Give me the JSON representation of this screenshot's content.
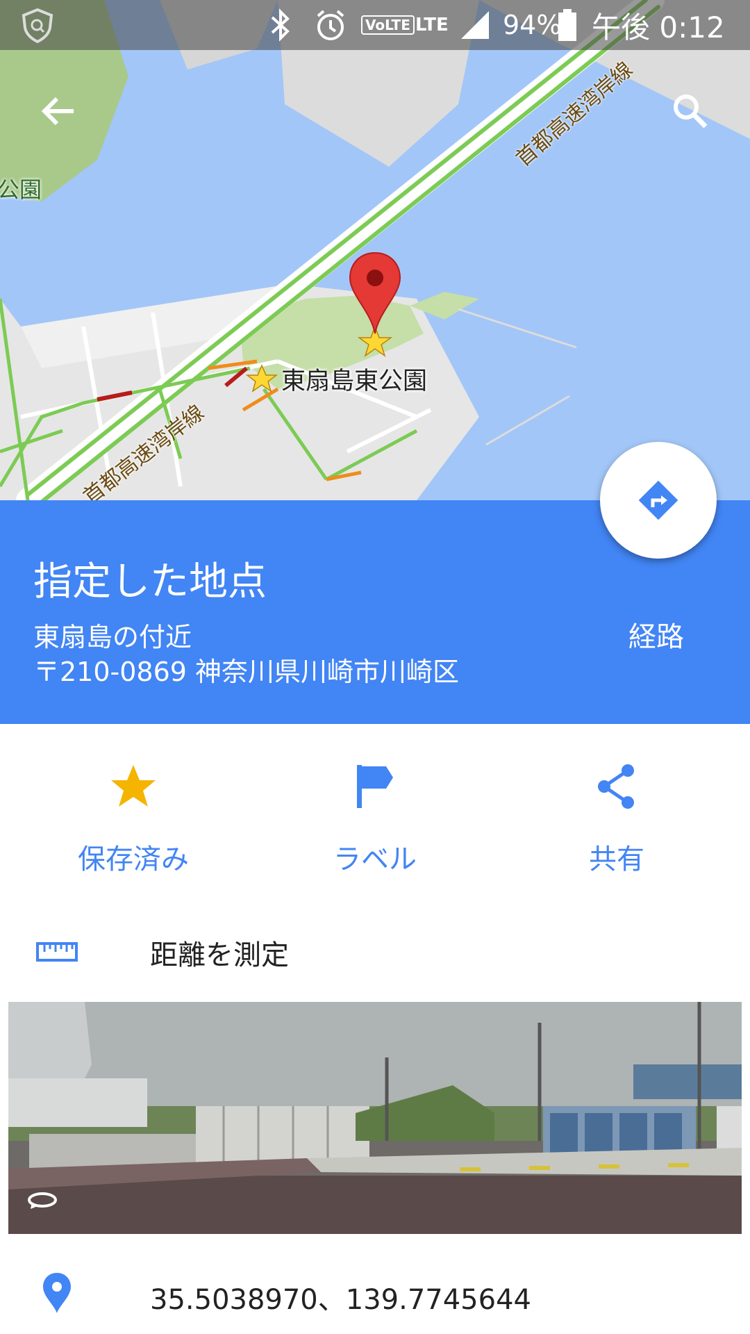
{
  "status_bar": {
    "battery": "94%",
    "network": "LTE",
    "volte": "VoLTE",
    "time": "午後 0:12"
  },
  "map": {
    "park_label": "東扇島東公園",
    "left_park_label": "公園",
    "highway_label_top": "首都高速湾岸線",
    "highway_label_bottom": "首都高速湾岸線"
  },
  "place": {
    "title": "指定した地点",
    "address_line1": "東扇島の付近",
    "address_line2": "〒210-0869 神奈川県川崎市川崎区",
    "route_label": "経路"
  },
  "actions": [
    {
      "label": "保存済み",
      "icon": "star-icon"
    },
    {
      "label": "ラベル",
      "icon": "flag-icon"
    },
    {
      "label": "共有",
      "icon": "share-icon"
    }
  ],
  "measure": {
    "label": "距離を測定",
    "icon": "ruler-icon"
  },
  "coordinates": {
    "value": "35.5038970、139.7745644",
    "icon": "location-pin-icon"
  },
  "colors": {
    "accent": "#4285f4",
    "star": "#f4b400",
    "pin": "#e53935"
  }
}
